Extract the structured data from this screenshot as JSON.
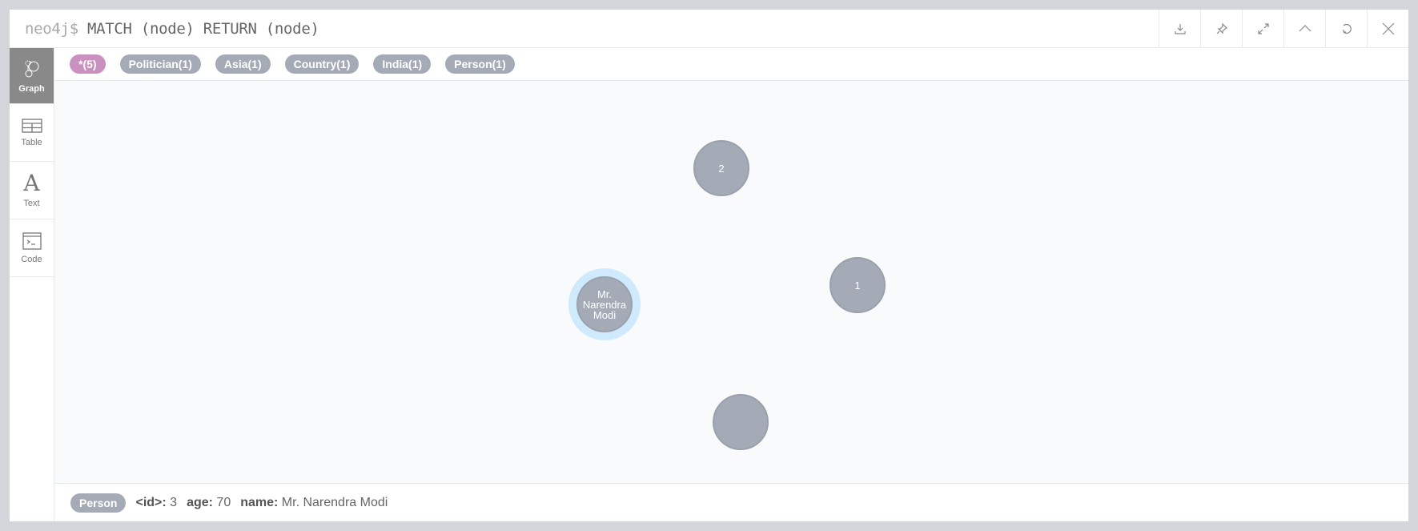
{
  "header": {
    "prompt": "neo4j$",
    "query": "MATCH (node) RETURN (node)",
    "buttons": [
      {
        "name": "download-icon"
      },
      {
        "name": "pin-icon"
      },
      {
        "name": "expand-icon"
      },
      {
        "name": "collapse-icon"
      },
      {
        "name": "rerun-icon"
      },
      {
        "name": "close-icon"
      }
    ]
  },
  "sidebar": {
    "items": [
      {
        "label": "Graph",
        "active": true
      },
      {
        "label": "Table"
      },
      {
        "label": "Text"
      },
      {
        "label": "Code"
      }
    ]
  },
  "labels": [
    {
      "text": "*(5)",
      "color": "#c990c0"
    },
    {
      "text": "Politician(1)"
    },
    {
      "text": "Asia(1)"
    },
    {
      "text": "Country(1)"
    },
    {
      "text": "India(1)"
    },
    {
      "text": "Person(1)"
    }
  ],
  "graph": {
    "nodes": [
      {
        "caption": "2"
      },
      {
        "caption": "1"
      },
      {
        "caption": "Mr. Narendra Modi",
        "selected": true
      },
      {
        "caption": ""
      }
    ],
    "node_color": "#a5abb6",
    "selection_color": "#cfeafc"
  },
  "footer": {
    "label": "Person",
    "props": [
      {
        "key": "<id>:",
        "value": "3"
      },
      {
        "key": "age:",
        "value": "70"
      },
      {
        "key": "name:",
        "value": "Mr. Narendra Modi"
      }
    ]
  }
}
